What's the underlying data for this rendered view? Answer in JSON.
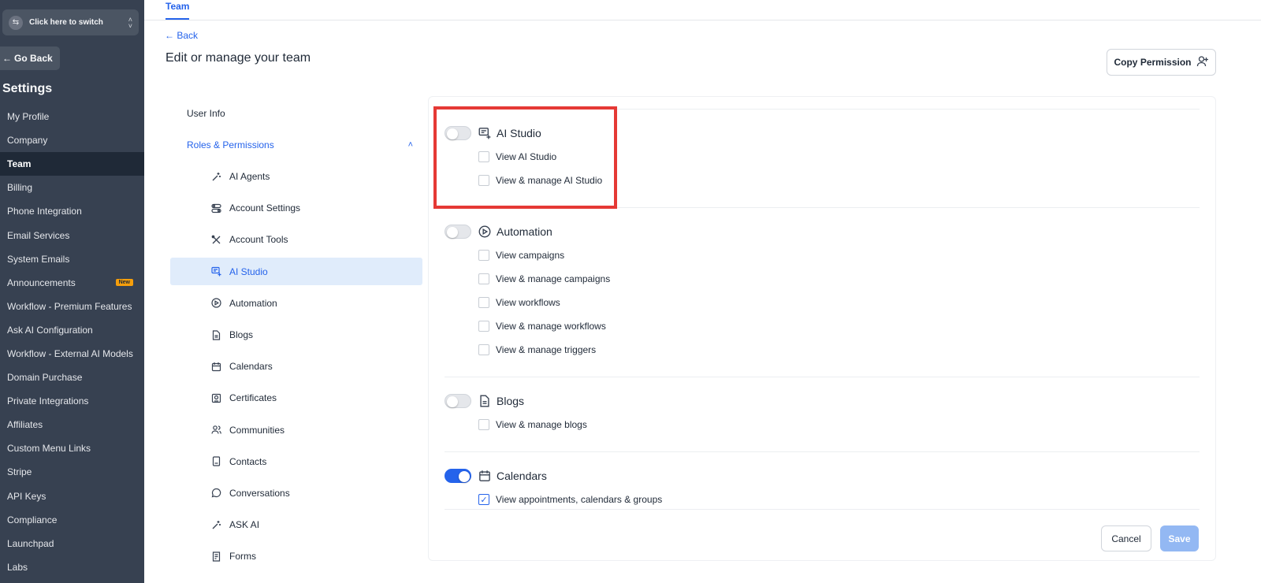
{
  "switcher": {
    "label": "Click here to switch"
  },
  "sidebar": {
    "go_back": "Go Back",
    "title": "Settings",
    "items": [
      {
        "label": "My Profile"
      },
      {
        "label": "Company"
      },
      {
        "label": "Team",
        "active": true
      },
      {
        "label": "Billing"
      },
      {
        "label": "Phone Integration"
      },
      {
        "label": "Email Services"
      },
      {
        "label": "System Emails"
      },
      {
        "label": "Announcements",
        "badge": "New"
      },
      {
        "label": "Workflow - Premium Features"
      },
      {
        "label": "Ask AI Configuration"
      },
      {
        "label": "Workflow - External AI Models"
      },
      {
        "label": "Domain Purchase"
      },
      {
        "label": "Private Integrations"
      },
      {
        "label": "Affiliates"
      },
      {
        "label": "Custom Menu Links"
      },
      {
        "label": "Stripe"
      },
      {
        "label": "API Keys"
      },
      {
        "label": "Compliance"
      },
      {
        "label": "Launchpad"
      },
      {
        "label": "Labs"
      }
    ]
  },
  "header": {
    "tab": "Team",
    "back": "Back",
    "title": "Edit or manage your team",
    "copy_permission": "Copy Permission"
  },
  "submenu": {
    "user_info": "User Info",
    "roles": "Roles & Permissions",
    "items": [
      {
        "label": "AI Agents",
        "icon": "wand-icon"
      },
      {
        "label": "Account Settings",
        "icon": "toggles-icon"
      },
      {
        "label": "Account Tools",
        "icon": "tools-icon"
      },
      {
        "label": "AI Studio",
        "icon": "ai-studio-icon",
        "active": true
      },
      {
        "label": "Automation",
        "icon": "play-circle-icon"
      },
      {
        "label": "Blogs",
        "icon": "document-icon"
      },
      {
        "label": "Calendars",
        "icon": "calendar-icon"
      },
      {
        "label": "Certificates",
        "icon": "certificate-icon"
      },
      {
        "label": "Communities",
        "icon": "users-icon"
      },
      {
        "label": "Contacts",
        "icon": "contact-book-icon"
      },
      {
        "label": "Conversations",
        "icon": "chat-bubble-icon"
      },
      {
        "label": "ASK AI",
        "icon": "wand-icon"
      },
      {
        "label": "Forms",
        "icon": "form-icon"
      }
    ]
  },
  "permissions": {
    "ai_studio": {
      "title": "AI Studio",
      "enabled": false,
      "items": [
        {
          "label": "View AI Studio",
          "checked": false
        },
        {
          "label": "View & manage AI Studio",
          "checked": false
        }
      ]
    },
    "automation": {
      "title": "Automation",
      "enabled": false,
      "items": [
        {
          "label": "View campaigns",
          "checked": false
        },
        {
          "label": "View & manage campaigns",
          "checked": false
        },
        {
          "label": "View workflows",
          "checked": false
        },
        {
          "label": "View & manage workflows",
          "checked": false
        },
        {
          "label": "View & manage triggers",
          "checked": false
        }
      ]
    },
    "blogs": {
      "title": "Blogs",
      "enabled": false,
      "items": [
        {
          "label": "View & manage blogs",
          "checked": false
        }
      ]
    },
    "calendars": {
      "title": "Calendars",
      "enabled": true,
      "items": [
        {
          "label": "View appointments, calendars & groups",
          "checked": true
        }
      ]
    }
  },
  "footer": {
    "cancel": "Cancel",
    "save": "Save"
  },
  "colors": {
    "primary": "#2563eb",
    "sidebar_bg": "#374151",
    "highlight": "#e53935",
    "badge": "#f59e0b"
  }
}
